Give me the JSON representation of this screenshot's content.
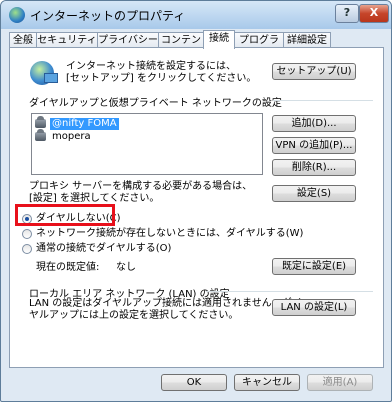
{
  "window": {
    "title": "インターネットのプロパティ",
    "help_label": "?",
    "close_label": "X"
  },
  "tabs": [
    "全般",
    "セキュリティ",
    "プライバシー",
    "コンテンツ",
    "接続",
    "プログラム",
    "詳細設定"
  ],
  "active_tab": "接続",
  "setup": {
    "description_line1": "インターネット接続を設定するには、",
    "description_line2": "[セットアップ] をクリックしてください。",
    "button_label": "セットアップ(U)"
  },
  "dialup": {
    "group_label": "ダイヤルアップと仮想プライベート ネットワークの設定",
    "connections": [
      "@nifty FOMA",
      "mopera"
    ],
    "selected": "@nifty FOMA",
    "add_button": "追加(D)...",
    "add_vpn_button": "VPN の追加(P)...",
    "remove_button": "削除(R)...",
    "settings_button": "設定(S)"
  },
  "proxy": {
    "description_line1": "プロキシ サーバーを構成する必要がある場合は、",
    "description_line2": "[設定] を選択してください。"
  },
  "dial_options": {
    "options": [
      "ダイヤルしない(C)",
      "ネットワーク接続が存在しないときには、ダイヤルする(W)",
      "通常の接続でダイヤルする(O)"
    ],
    "selected_index": 0,
    "default_label": "現在の既定値:",
    "default_value": "なし",
    "set_default_button": "既定に設定(E)"
  },
  "lan": {
    "group_label": "ローカル エリア ネットワーク (LAN) の設定",
    "description_line1": "LAN の設定はダイヤルアップ接続には適用されません。ダイ",
    "description_line2": "ヤルアップには上の設定を選択してください。",
    "settings_button": "LAN の設定(L)"
  },
  "footer": {
    "ok_button": "OK",
    "cancel_button": "キャンセル",
    "apply_button": "適用(A)"
  },
  "colors": {
    "highlight_box": "#e8101b",
    "selection": "#3399ff"
  }
}
